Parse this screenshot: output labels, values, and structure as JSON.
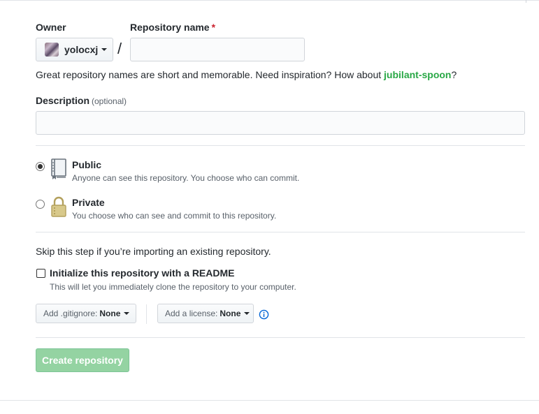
{
  "owner": {
    "label": "Owner",
    "selected": "yolocxj"
  },
  "repository": {
    "label": "Repository name",
    "required_mark": "*",
    "value": "",
    "separator": "/"
  },
  "hint": {
    "text": "Great repository names are short and memorable. Need inspiration? How about ",
    "suggestion": "jubilant-spoon",
    "end": "?"
  },
  "description": {
    "label": "Description",
    "optional": "(optional)",
    "value": ""
  },
  "visibility": {
    "public": {
      "title": "Public",
      "note": "Anyone can see this repository. You choose who can commit.",
      "checked": true
    },
    "private": {
      "title": "Private",
      "note": "You choose who can see and commit to this repository.",
      "checked": false
    }
  },
  "import": {
    "skip_text": "Skip this step if you’re importing an existing repository."
  },
  "readme": {
    "label": "Initialize this repository with a README",
    "note": "This will let you immediately clone the repository to your computer.",
    "checked": false
  },
  "gitignore": {
    "prefix": "Add .gitignore:",
    "value": "None"
  },
  "license": {
    "prefix": "Add a license:",
    "value": "None"
  },
  "submit": {
    "label": "Create repository",
    "disabled": true
  },
  "colors": {
    "accent_green": "#28a745",
    "button_disabled": "#94d3a2",
    "info_blue": "#0366d6",
    "required_red": "#cb2431"
  },
  "icons": {
    "public": "repo-book-icon",
    "private": "lock-icon",
    "info": "info-icon",
    "caret": "caret-down-icon"
  }
}
